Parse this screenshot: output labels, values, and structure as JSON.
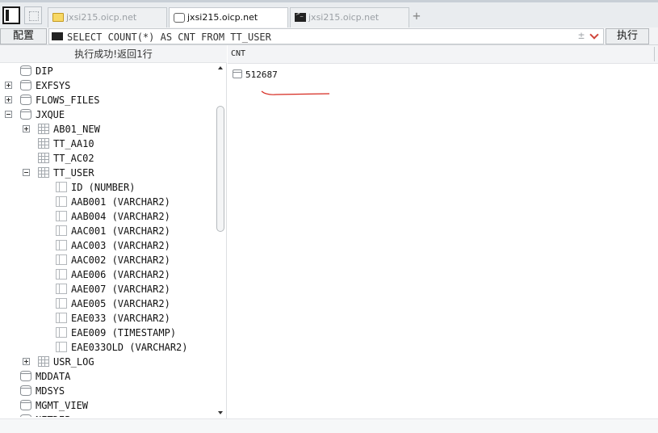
{
  "tabs": [
    {
      "label": "jxsi215.oicp.net",
      "icon": "folder-icon",
      "active": false
    },
    {
      "label": "jxsi215.oicp.net",
      "icon": "database-icon",
      "active": true
    },
    {
      "label": "jxsi215.oicp.net",
      "icon": "terminal-icon",
      "active": false
    }
  ],
  "tab_add_label": "+",
  "toolbar": {
    "config_label": "配置",
    "sql_query": "SELECT COUNT(*) AS CNT FROM TT_USER",
    "plus_minus_label": "±",
    "execute_label": "执行"
  },
  "status_message": "执行成功!返回1行",
  "tree": {
    "items": [
      {
        "label": "DIP",
        "type": "schema",
        "expander": "none"
      },
      {
        "label": "EXFSYS",
        "type": "schema",
        "expander": "plus"
      },
      {
        "label": "FLOWS_FILES",
        "type": "schema",
        "expander": "plus"
      },
      {
        "label": "JXQUE",
        "type": "schema",
        "expander": "minus"
      },
      {
        "label": "AB01_NEW",
        "type": "table",
        "expander": "plus"
      },
      {
        "label": "TT_AA10",
        "type": "table",
        "expander": "none"
      },
      {
        "label": "TT_AC02",
        "type": "table",
        "expander": "none"
      },
      {
        "label": "TT_USER",
        "type": "table",
        "expander": "minus"
      },
      {
        "label": "ID (NUMBER)",
        "type": "column",
        "expander": "none"
      },
      {
        "label": "AAB001 (VARCHAR2)",
        "type": "column",
        "expander": "none"
      },
      {
        "label": "AAB004 (VARCHAR2)",
        "type": "column",
        "expander": "none"
      },
      {
        "label": "AAC001 (VARCHAR2)",
        "type": "column",
        "expander": "none"
      },
      {
        "label": "AAC003 (VARCHAR2)",
        "type": "column",
        "expander": "none"
      },
      {
        "label": "AAC002 (VARCHAR2)",
        "type": "column",
        "expander": "none"
      },
      {
        "label": "AAE006 (VARCHAR2)",
        "type": "column",
        "expander": "none"
      },
      {
        "label": "AAE007 (VARCHAR2)",
        "type": "column",
        "expander": "none"
      },
      {
        "label": "AAE005 (VARCHAR2)",
        "type": "column",
        "expander": "none"
      },
      {
        "label": "EAE033 (VARCHAR2)",
        "type": "column",
        "expander": "none"
      },
      {
        "label": "EAE009 (TIMESTAMP)",
        "type": "column",
        "expander": "none"
      },
      {
        "label": "EAE033OLD (VARCHAR2)",
        "type": "column",
        "expander": "none"
      },
      {
        "label": "USR_LOG",
        "type": "table",
        "expander": "plus"
      },
      {
        "label": "MDDATA",
        "type": "schema",
        "expander": "none"
      },
      {
        "label": "MDSYS",
        "type": "schema",
        "expander": "none"
      },
      {
        "label": "MGMT_VIEW",
        "type": "schema",
        "expander": "none"
      },
      {
        "label": "NETDEP",
        "type": "schema",
        "expander": "none"
      }
    ]
  },
  "results": {
    "columns": [
      "CNT"
    ],
    "rows": [
      [
        "512687"
      ]
    ]
  },
  "colors": {
    "accent_red": "#d0453b",
    "annotation_red": "#d62a20"
  }
}
